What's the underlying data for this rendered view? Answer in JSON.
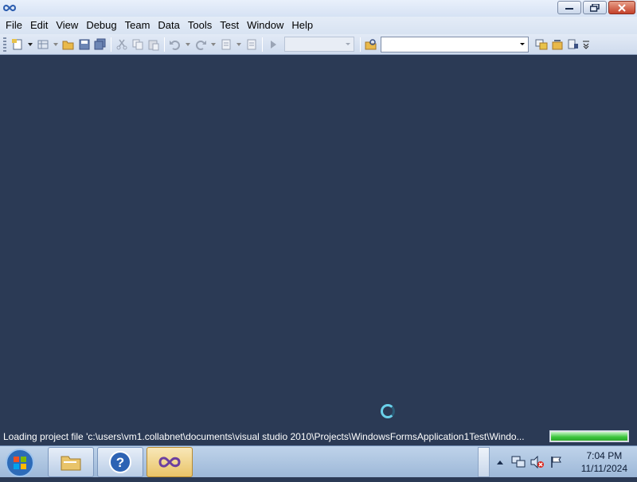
{
  "menu": [
    "File",
    "Edit",
    "View",
    "Debug",
    "Team",
    "Data",
    "Tools",
    "Test",
    "Window",
    "Help"
  ],
  "status": {
    "text": "Loading project file 'c:\\users\\vm1.collabnet\\documents\\visual studio 2010\\Projects\\WindowsFormsApplication1Test\\Windo...",
    "progress": 1.0
  },
  "clock": {
    "time": "7:04 PM",
    "date": "11/11/2024"
  },
  "icons": {
    "app": "vs-infinity-icon",
    "toolbar": [
      "new-project-icon",
      "add-item-icon",
      "open-file-icon",
      "save-icon",
      "save-all-icon",
      "cut-icon",
      "copy-icon",
      "paste-icon",
      "undo-icon",
      "redo-icon",
      "navigate-backward-icon",
      "navigate-forward-icon",
      "start-debugging-icon",
      "find-in-files-icon",
      "solution-explorer-icon",
      "properties-icon",
      "object-browser-icon"
    ],
    "taskbar": [
      "windows-start-icon",
      "file-explorer-icon",
      "help-icon",
      "visual-studio-icon"
    ],
    "tray": [
      "show-hidden-icons-icon",
      "network-icon",
      "volume-muted-icon",
      "action-center-flag-icon"
    ]
  },
  "colors": {
    "workspace": "#2b3a55",
    "progress": "#3bc43b"
  }
}
